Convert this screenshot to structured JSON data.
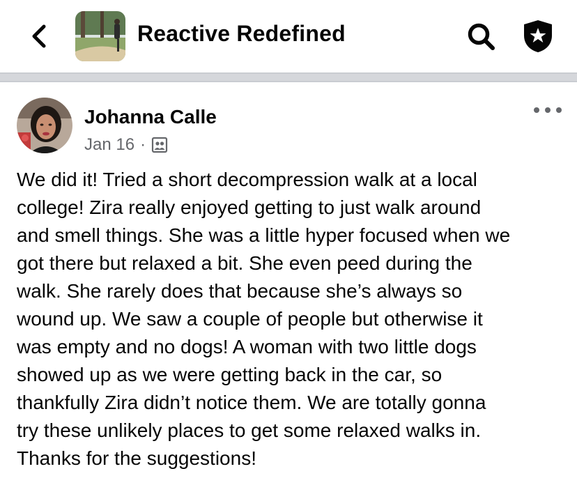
{
  "header": {
    "back_icon": "chevron-left-icon",
    "group_name": "Reactive Redefined",
    "search_icon": "search-icon",
    "admin_icon": "shield-star-icon"
  },
  "post": {
    "author": "Johanna Calle",
    "date": "Jan 16",
    "separator": "·",
    "audience_icon": "members-group-icon",
    "more_icon": "more-options-icon",
    "text_lines": [
      "We did it! Tried a short decompression walk at a local",
      "college! Zira really enjoyed getting to just walk around",
      "and smell things. She was a little hyper focused when we",
      "got there but relaxed a bit. She even peed during the",
      "walk. She rarely does that because she’s always so",
      "wound up. We saw a couple of people but otherwise it",
      "was empty and no dogs! A woman with two little dogs",
      "showed up as we were getting back in the car, so",
      "thankfully Zira didn’t notice them. We are totally gonna",
      "try these unlikely places to get some relaxed walks in.",
      "Thanks for the suggestions!"
    ]
  },
  "colors": {
    "text_primary": "#050505",
    "text_secondary": "#65676b",
    "divider": "#c9ccd1"
  }
}
